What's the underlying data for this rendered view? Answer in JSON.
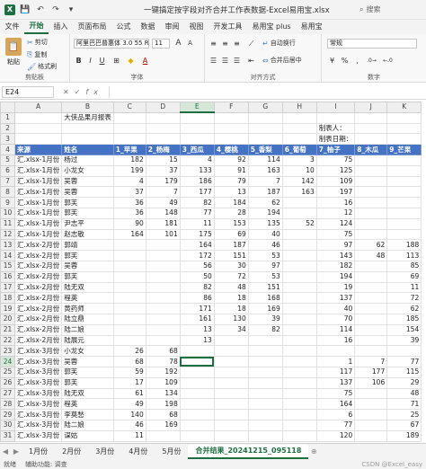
{
  "window": {
    "title": "一键搞定按字段对齐合并工作表数据-Excel易用宝.xlsx",
    "search_placeholder": "搜索",
    "autosave_icon": "save-icon"
  },
  "menu": [
    "文件",
    "开始",
    "插入",
    "页面布局",
    "公式",
    "数据",
    "审阅",
    "视图",
    "开发工具",
    "易用宝 plus",
    "易用宝"
  ],
  "ribbon": {
    "clipboard": {
      "paste": "粘贴",
      "cut": "剪切",
      "copy": "复制",
      "format_painter": "格式刷",
      "label": "剪贴板"
    },
    "font": {
      "font_name": "阿里巴巴普惠体 3.0 55 Regu",
      "font_size": "11",
      "bold": "B",
      "italic": "I",
      "underline": "U",
      "grow": "A",
      "shrink": "A",
      "color_a": "A",
      "label": "字体"
    },
    "alignment": {
      "wrap": "自动换行",
      "merge": "合并后居中",
      "label": "对齐方式"
    },
    "number": {
      "format": "常规",
      "percent": "%",
      "comma": ",",
      "label": "数字"
    }
  },
  "formula_bar": {
    "name_box": "E24",
    "cancel": "✕",
    "confirm": "✓",
    "fx": "fx",
    "value": ""
  },
  "columns": [
    "A",
    "B",
    "C",
    "D",
    "E",
    "F",
    "G",
    "H",
    "I",
    "J",
    "K"
  ],
  "selected_column": "E",
  "selected_row": 24,
  "rows": [
    {
      "n": 1,
      "cells": [
        "",
        "大侠品果月报表",
        "",
        "",
        "",
        "",
        "",
        "",
        "",
        "",
        ""
      ]
    },
    {
      "n": 2,
      "cells": [
        "",
        "",
        "",
        "",
        "",
        "",
        "",
        "",
        "制表人：",
        "",
        ""
      ]
    },
    {
      "n": 3,
      "cells": [
        "",
        "",
        "",
        "",
        "",
        "",
        "",
        "",
        "制表日期：",
        "",
        ""
      ]
    },
    {
      "n": 4,
      "cells": [
        "来源",
        "姓名",
        "1_苹果",
        "2_杨梅",
        "3_西瓜",
        "4_樱桃",
        "5_香梨",
        "6_葡萄",
        "7_柚子",
        "8_木瓜",
        "9_芒果"
      ]
    },
    {
      "n": 5,
      "cells": [
        "汇.xlsx-1月份",
        "杨过",
        "182",
        "15",
        "4",
        "92",
        "114",
        "3",
        "75",
        "",
        ""
      ]
    },
    {
      "n": 6,
      "cells": [
        "汇.xlsx-1月份",
        "小龙女",
        "199",
        "37",
        "133",
        "91",
        "163",
        "10",
        "125",
        "",
        ""
      ]
    },
    {
      "n": 7,
      "cells": [
        "汇.xlsx-1月份",
        "吴蓉",
        "4",
        "179",
        "186",
        "79",
        "7",
        "142",
        "109",
        "",
        ""
      ]
    },
    {
      "n": 8,
      "cells": [
        "汇.xlsx-1月份",
        "吴蓉",
        "37",
        "7",
        "177",
        "13",
        "187",
        "163",
        "197",
        "",
        ""
      ]
    },
    {
      "n": 9,
      "cells": [
        "汇.xlsx-1月份",
        "郭芙",
        "36",
        "49",
        "82",
        "184",
        "62",
        "",
        "16",
        "",
        ""
      ]
    },
    {
      "n": 10,
      "cells": [
        "汇.xlsx-1月份",
        "郭芙",
        "36",
        "148",
        "77",
        "28",
        "194",
        "",
        "12",
        "",
        ""
      ]
    },
    {
      "n": 11,
      "cells": [
        "汇.xlsx-1月份",
        "尹志平",
        "90",
        "181",
        "11",
        "153",
        "135",
        "52",
        "124",
        "",
        ""
      ]
    },
    {
      "n": 12,
      "cells": [
        "汇.xlsx-1月份",
        "赵志敬",
        "164",
        "101",
        "175",
        "69",
        "40",
        "",
        "75",
        "",
        ""
      ]
    },
    {
      "n": 13,
      "cells": [
        "汇.xlsx-2月份",
        "郭靖",
        "",
        "",
        "164",
        "187",
        "46",
        "",
        "97",
        "62",
        "188"
      ]
    },
    {
      "n": 14,
      "cells": [
        "汇.xlsx-2月份",
        "郭芙",
        "",
        "",
        "172",
        "151",
        "53",
        "",
        "143",
        "48",
        "113"
      ]
    },
    {
      "n": 15,
      "cells": [
        "汇.xlsx-2月份",
        "吴蓉",
        "",
        "",
        "56",
        "30",
        "97",
        "",
        "182",
        "",
        "85"
      ]
    },
    {
      "n": 16,
      "cells": [
        "汇.xlsx-2月份",
        "郭芙",
        "",
        "",
        "50",
        "72",
        "53",
        "",
        "194",
        "",
        "69"
      ]
    },
    {
      "n": 17,
      "cells": [
        "汇.xlsx-2月份",
        "陆无双",
        "",
        "",
        "82",
        "48",
        "151",
        "",
        "19",
        "",
        "11"
      ]
    },
    {
      "n": 18,
      "cells": [
        "汇.xlsx-2月份",
        "程英",
        "",
        "",
        "86",
        "18",
        "168",
        "",
        "137",
        "",
        "72"
      ]
    },
    {
      "n": 19,
      "cells": [
        "汇.xlsx-2月份",
        "黄药师",
        "",
        "",
        "171",
        "18",
        "169",
        "",
        "40",
        "",
        "62"
      ]
    },
    {
      "n": 20,
      "cells": [
        "汇.xlsx-2月份",
        "陆立鼎",
        "",
        "",
        "161",
        "130",
        "39",
        "",
        "70",
        "",
        "185"
      ]
    },
    {
      "n": 21,
      "cells": [
        "汇.xlsx-2月份",
        "陆二娘",
        "",
        "",
        "13",
        "34",
        "82",
        "",
        "114",
        "",
        "154"
      ]
    },
    {
      "n": 22,
      "cells": [
        "汇.xlsx-2月份",
        "陆展元",
        "",
        "",
        "13",
        "",
        "",
        "",
        "16",
        "",
        "39"
      ]
    },
    {
      "n": 23,
      "cells": [
        "汇.xlsx-3月份",
        "小龙女",
        "26",
        "68",
        "",
        "",
        "",
        "",
        "",
        "",
        ""
      ]
    },
    {
      "n": 24,
      "cells": [
        "汇.xlsx-3月份",
        "吴蓉",
        "68",
        "78",
        "",
        "",
        "",
        "",
        "1",
        "7",
        "77"
      ]
    },
    {
      "n": 25,
      "cells": [
        "汇.xlsx-3月份",
        "郭芙",
        "59",
        "192",
        "",
        "",
        "",
        "",
        "117",
        "177",
        "115"
      ]
    },
    {
      "n": 26,
      "cells": [
        "汇.xlsx-3月份",
        "郭芙",
        "17",
        "109",
        "",
        "",
        "",
        "",
        "137",
        "106",
        "29"
      ]
    },
    {
      "n": 27,
      "cells": [
        "汇.xlsx-3月份",
        "陆无双",
        "61",
        "134",
        "",
        "",
        "",
        "",
        "75",
        "",
        "48"
      ]
    },
    {
      "n": 28,
      "cells": [
        "汇.xlsx-3月份",
        "程英",
        "49",
        "198",
        "",
        "",
        "",
        "",
        "164",
        "",
        "71"
      ]
    },
    {
      "n": 29,
      "cells": [
        "汇.xlsx-3月份",
        "李莫愁",
        "140",
        "68",
        "",
        "",
        "",
        "",
        "6",
        "",
        "25"
      ]
    },
    {
      "n": 30,
      "cells": [
        "汇.xlsx-3月份",
        "陆二娘",
        "46",
        "169",
        "",
        "",
        "",
        "",
        "77",
        "",
        "67"
      ]
    },
    {
      "n": 31,
      "cells": [
        "汇.xlsx-3月份",
        "谋姑",
        "11",
        "",
        "",
        "",
        "",
        "",
        "120",
        "",
        "189"
      ]
    }
  ],
  "sheet_tabs": [
    "1月份",
    "2月份",
    "3月份",
    "4月份",
    "5月份",
    "合并结果_20241215_095118"
  ],
  "active_sheet_index": 5,
  "status": {
    "left": "就绪",
    "accessibility": "辅助功能: 调查",
    "watermark": "CSDN @Excel_easy"
  },
  "colors": {
    "accent": "#1d6f42",
    "header_fill": "#4472c4"
  }
}
